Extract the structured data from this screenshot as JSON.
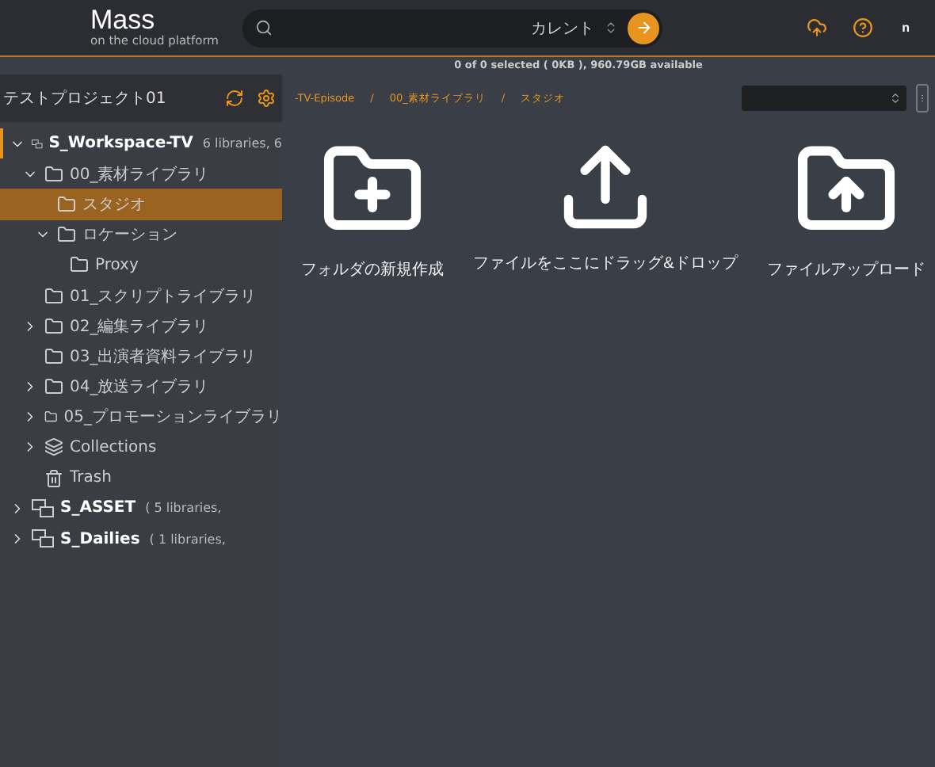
{
  "header": {
    "logo_title": "Mass",
    "logo_subtitle": "on the cloud platform",
    "search": {
      "scope": "カレント"
    },
    "user_initial": "n"
  },
  "status": "0 of 0 selected ( 0KB ), 960.79GB available",
  "sidebar": {
    "project": "テストプロジェクト01",
    "tree": [
      {
        "label": "S_Workspace-TV",
        "info": "6 libraries, 6",
        "kind": "workspace",
        "expanded": true,
        "selected": false,
        "children": [
          {
            "label": "00_素材ライブラリ",
            "kind": "folder",
            "expanded": true,
            "selected": false,
            "children": [
              {
                "label": "スタジオ",
                "kind": "folder",
                "selected": true
              },
              {
                "label": "ロケーション",
                "kind": "folder",
                "expanded": true,
                "selected": false,
                "children": [
                  {
                    "label": "Proxy",
                    "kind": "folder",
                    "selected": false
                  }
                ]
              }
            ]
          },
          {
            "label": "01_スクリプトライブラリ",
            "kind": "folder",
            "selected": false
          },
          {
            "label": "02_編集ライブラリ",
            "kind": "folder",
            "expanded": false,
            "selected": false
          },
          {
            "label": "03_出演者資料ライブラリ",
            "kind": "folder",
            "selected": false
          },
          {
            "label": "04_放送ライブラリ",
            "kind": "folder",
            "expanded": false,
            "selected": false
          },
          {
            "label": "05_プロモーションライブラリ",
            "kind": "folder",
            "expanded": false,
            "selected": false
          },
          {
            "label": "Collections",
            "kind": "collections",
            "expanded": false,
            "selected": false
          },
          {
            "label": "Trash",
            "kind": "trash",
            "selected": false
          }
        ]
      },
      {
        "label": "S_ASSET",
        "info": "( 5 libraries,",
        "kind": "workspace",
        "expanded": false,
        "selected": false
      },
      {
        "label": "S_Dailies",
        "info": "( 1 libraries,",
        "kind": "workspace",
        "expanded": false,
        "selected": false
      }
    ]
  },
  "breadcrumb": {
    "separator": "/",
    "items": [
      "-TV-Episode",
      "00_素材ライブラリ",
      "スタジオ"
    ]
  },
  "actions": [
    {
      "kind": "new-folder",
      "label": "フォルダの新規作成"
    },
    {
      "kind": "drop",
      "label": "ファイルをここにドラッグ&ドロップ"
    },
    {
      "kind": "upload",
      "label": "ファイルアップロード"
    }
  ]
}
